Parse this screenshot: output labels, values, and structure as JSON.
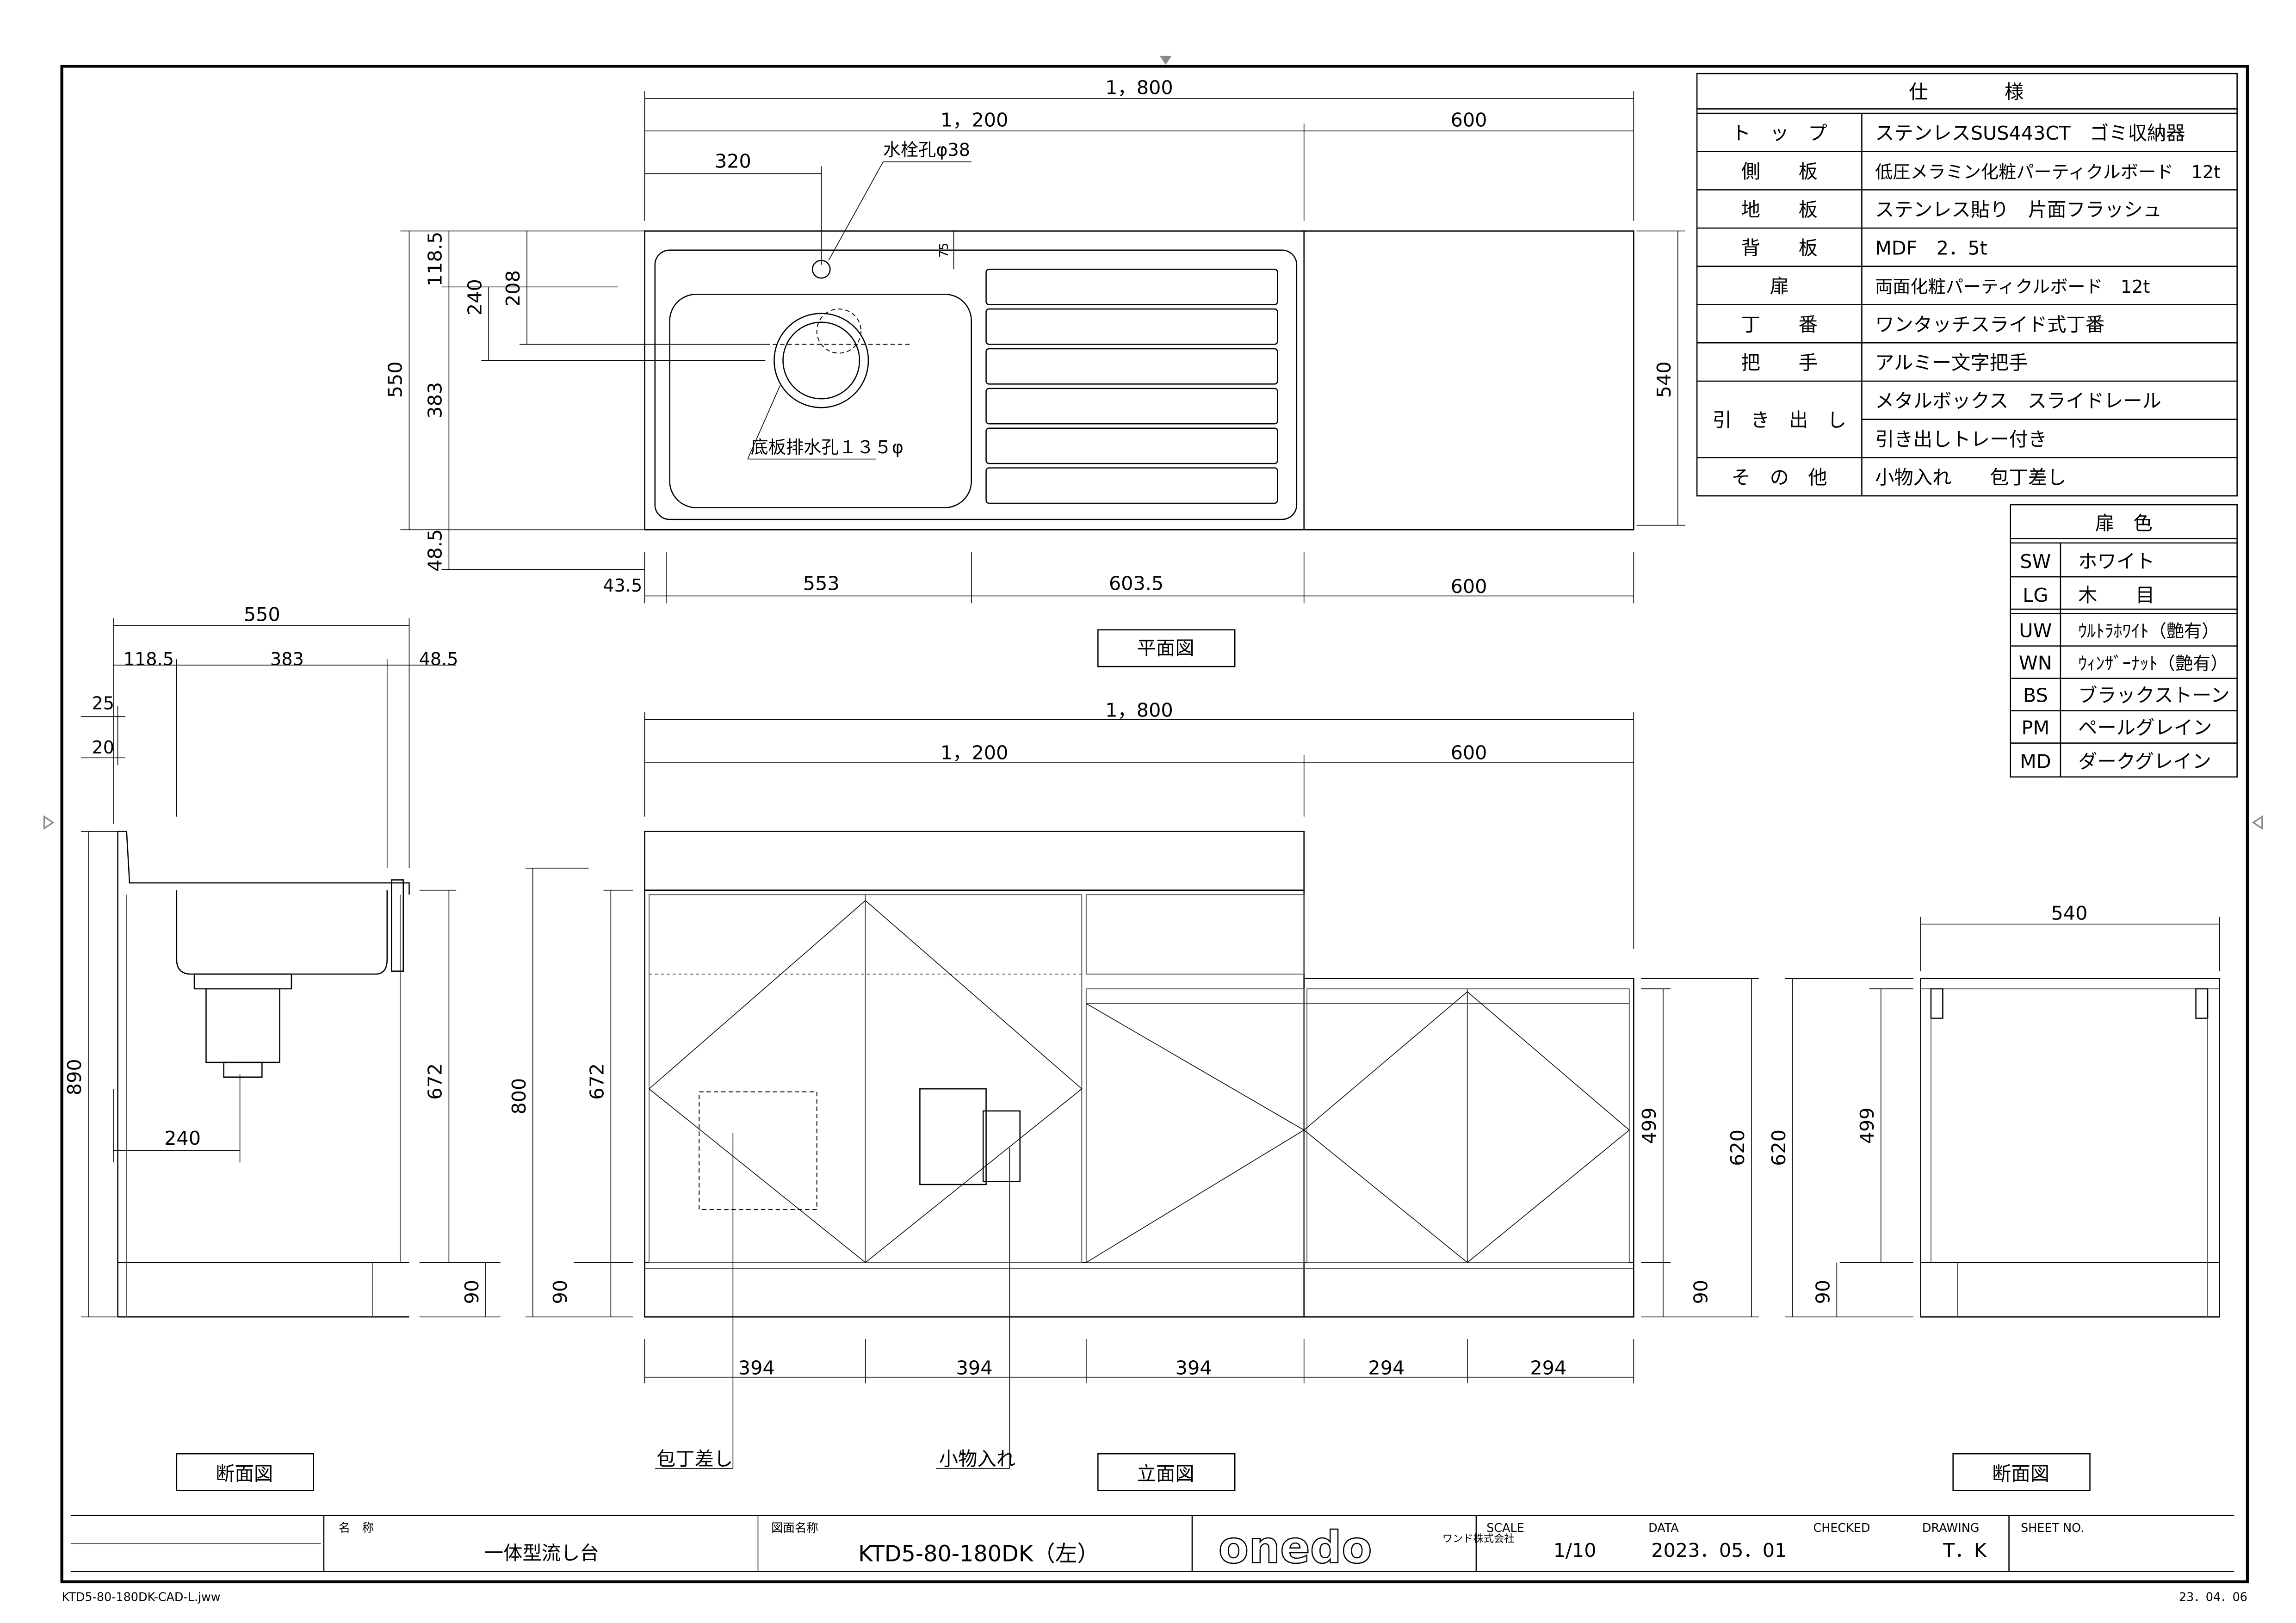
{
  "spec_table": {
    "title": "仕　　　　様",
    "rows": [
      {
        "label": "ト　ッ　プ",
        "value": "ステンレスSUS443CT　ゴミ収納器"
      },
      {
        "label": "側　　板",
        "value": "低圧メラミン化粧パーティクルボード　12t"
      },
      {
        "label": "地　　板",
        "value": "ステンレス貼り　片面フラッシュ"
      },
      {
        "label": "背　　板",
        "value": "MDF　2．5t"
      },
      {
        "label": "扉",
        "value": "両面化粧パーティクルボード　12t"
      },
      {
        "label": "丁　　番",
        "value": "ワンタッチスライド式丁番"
      },
      {
        "label": "把　　手",
        "value": "アルミー文字把手"
      },
      {
        "label": "引　き　出　し",
        "value": "メタルボックス　スライドレール",
        "value2": "引き出しトレー付き"
      },
      {
        "label": "そ　の　他",
        "value": "小物入れ　　包丁差し"
      }
    ]
  },
  "color_table": {
    "title": "扉　色",
    "rows": [
      {
        "code": "SW",
        "name": "ホワイト"
      },
      {
        "code": "LG",
        "name": "木　　目"
      },
      {
        "code": "UW",
        "name": "ｳﾙﾄﾗﾎﾜｲﾄ（艶有）"
      },
      {
        "code": "WN",
        "name": "ｳｨﾝｻﾞｰﾅｯﾄ（艶有）"
      },
      {
        "code": "BS",
        "name": "ブラックストーン"
      },
      {
        "code": "PM",
        "name": "ペールグレイン"
      },
      {
        "code": "MD",
        "name": "ダークグレイン"
      }
    ]
  },
  "plan_view": {
    "label": "平面図",
    "dims": {
      "total": "1，800",
      "sink": "1，200",
      "right": "600",
      "tap_offset": "320",
      "tap_hole": "水栓孔φ38",
      "drain_hole": "底板排水孔１３５φ",
      "d75": "75",
      "depth550": "550",
      "d118": "118.5",
      "d383": "383",
      "d48": "48.5",
      "d240": "240",
      "d208": "208",
      "depth540": "540",
      "b43": "43.5",
      "b553": "553",
      "b603": "603.5",
      "b600": "600"
    }
  },
  "elevation_view": {
    "label": "立面図",
    "dims": {
      "total": "1，800",
      "sink": "1，200",
      "right": "600",
      "h800": "800",
      "h672": "672",
      "h90a": "90",
      "h499": "499",
      "h620": "620",
      "h90b": "90",
      "w1": "394",
      "w2": "394",
      "w3": "394",
      "w4": "294",
      "w5": "294"
    },
    "callouts": {
      "knife": "包丁差し",
      "pocket": "小物入れ"
    }
  },
  "section_left": {
    "label": "断面図",
    "dims": {
      "w550": "550",
      "d118": "118.5",
      "d383": "383",
      "d48": "48.5",
      "d25": "25",
      "d20": "20",
      "h890": "890",
      "h672": "672",
      "h90": "90",
      "d240": "240"
    }
  },
  "section_right": {
    "label": "断面図",
    "dims": {
      "w540": "540",
      "h499": "499",
      "h620": "620",
      "h90": "90"
    }
  },
  "title_block": {
    "name_label": "名　称",
    "name": "一体型流し台",
    "drawing_name_label": "図面名称",
    "drawing_name": "KTD5-80-180DK（左）",
    "logo": "onedo",
    "company": "ワンド株式会社",
    "scale_label": "SCALE",
    "scale": "1/10",
    "date_label": "DATA",
    "date": "2023．05．01",
    "checked_label": "CHECKED",
    "drawing_label": "DRAWING",
    "drawing_by": "T．K",
    "sheet_label": "SHEET NO."
  },
  "footer": {
    "file": "KTD5-80-180DK-CAD-L.jww",
    "date": "23．04．06"
  }
}
